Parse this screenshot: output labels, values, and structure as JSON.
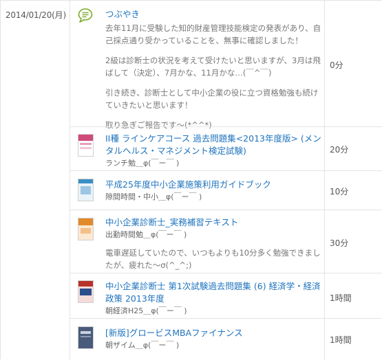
{
  "date": "2014/01/20(月)",
  "entries": [
    {
      "kind": "tweet",
      "icon": "speech-bubble-icon",
      "title": "つぶやき",
      "paragraphs": [
        "去年11月に受験した知的財産管理技能検定の発表があり、自己採点通り受かっていることを、無事に確認しました！",
        "2級は診断士の状況を考えて受けたいと思いますが、3月は飛ばして（決定）、7月かな、11月かな…(￣^￣)",
        "引き続き、診断士として中小企業の役に立つ資格勉強も続けていきたいと思います！",
        "取り急ぎご報告です～(*^^*)"
      ],
      "time": "0分"
    },
    {
      "kind": "book",
      "icon": "book-cover-icon",
      "cover_color": "#d04a7a",
      "title": "II種 ラインケアコース 過去問題集<2013年度版> (メンタルヘルス・マネジメント検定試験)",
      "sub": "ランチ勉＿φ(￣ー￣ )",
      "time": "20分"
    },
    {
      "kind": "book",
      "icon": "book-cover-icon",
      "cover_color": "#3a8fc4",
      "title": "平成25年度中小企業施策利用ガイドブック",
      "sub": "隙間時間・中小＿φ(￣ー￣ )",
      "time": "10分"
    },
    {
      "kind": "book",
      "icon": "book-cover-icon",
      "cover_color": "#e08a2a",
      "title": "中小企業診断士_実務補習テキスト",
      "sub": "出勤時間勉＿φ(￣ー￣ )",
      "paragraphs": [
        "電車遅延していたので、いつもよりも10分多く勉強できましたが、疲れた〜σ(^_^;)"
      ],
      "time": "30分"
    },
    {
      "kind": "book",
      "icon": "book-cover-icon",
      "cover_color": "#b8322c",
      "title": "中小企業診断士 第1次試験過去問題集 (6) 経済学・経済政策 2013年度",
      "sub": "朝経済H25＿φ(￣ー￣ )",
      "time": "1時間"
    },
    {
      "kind": "book",
      "icon": "book-cover-icon",
      "cover_color": "#4a5a7a",
      "title": "[新版]グロービスMBAファイナンス",
      "sub": "朝ザイム＿φ(￣ー￣ )",
      "time": "1時間"
    }
  ]
}
